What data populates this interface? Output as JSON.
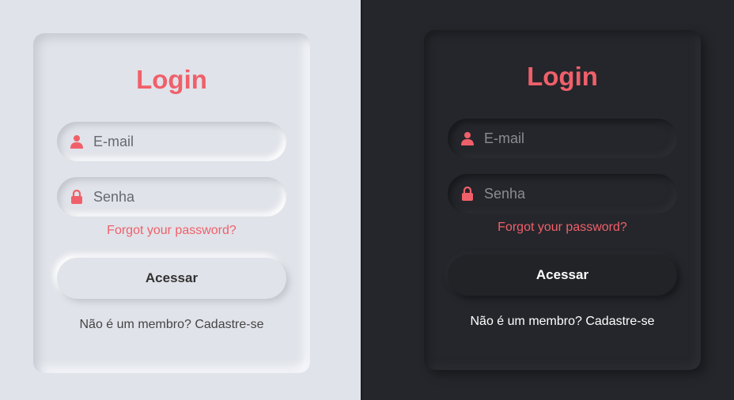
{
  "colors": {
    "accent": "#f0606a",
    "light_bg": "#e0e3e9",
    "dark_bg": "#25262b"
  },
  "light": {
    "title": "Login",
    "email": {
      "placeholder": "E-mail",
      "value": "",
      "icon": "user-icon"
    },
    "password": {
      "placeholder": "Senha",
      "value": "",
      "icon": "lock-icon"
    },
    "forgot_label": "Forgot your password?",
    "submit_label": "Acessar",
    "signup_prompt": "Não é um membro?",
    "signup_link": "Cadastre-se"
  },
  "dark": {
    "title": "Login",
    "email": {
      "placeholder": "E-mail",
      "value": "",
      "icon": "user-icon"
    },
    "password": {
      "placeholder": "Senha",
      "value": "",
      "icon": "lock-icon"
    },
    "forgot_label": "Forgot your password?",
    "submit_label": "Acessar",
    "signup_prompt": "Não é um membro?",
    "signup_link": "Cadastre-se"
  }
}
